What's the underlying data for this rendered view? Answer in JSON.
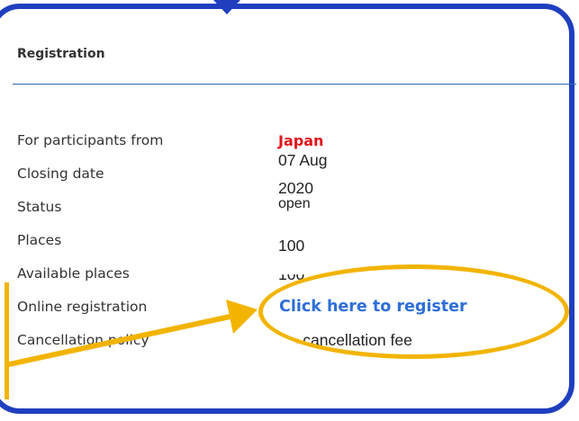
{
  "section": {
    "heading": "Registration"
  },
  "details": [
    {
      "label": "For participants from",
      "value": "Japan"
    },
    {
      "label": "Closing date",
      "value_line1": "07 Aug",
      "value_line2": "2020"
    },
    {
      "label": "Status",
      "value": "open"
    },
    {
      "label": "Places",
      "value": "100"
    },
    {
      "label": "Available places",
      "value": "100"
    },
    {
      "label": "Online registration",
      "link_text": "Click here to register"
    },
    {
      "label": "Cancellation policy",
      "value": "No cancellation fee"
    }
  ],
  "colors": {
    "frame": "#1f3fbf",
    "highlight": "#f2b400",
    "country": "#e0141c",
    "link": "#2f6ed8"
  }
}
